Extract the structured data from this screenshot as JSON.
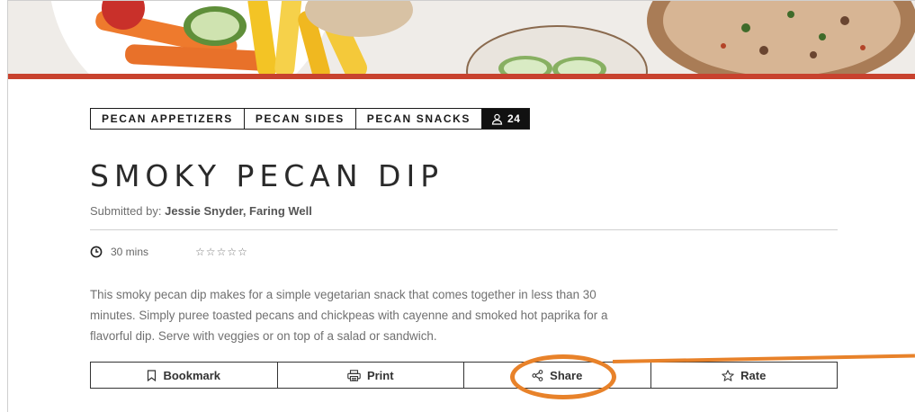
{
  "recipe": {
    "tags": [
      "PECAN APPETIZERS",
      "PECAN SIDES",
      "PECAN SNACKS"
    ],
    "user_count": "24",
    "title": "SMOKY PECAN DIP",
    "submitted_prefix": "Submitted by: ",
    "submitted_by": "Jessie Snyder, Faring Well",
    "time": "30 mins",
    "rating_stars": [
      "☆",
      "☆",
      "☆",
      "☆",
      "☆"
    ],
    "description": "This smoky pecan dip makes for a simple vegetarian snack that comes together in less than 30 minutes. Simply puree toasted pecans and chickpeas with cayenne and smoked hot paprika for a flavorful dip. Serve with veggies or on top of a salad or sandwich."
  },
  "actions": {
    "bookmark": "Bookmark",
    "print": "Print",
    "share": "Share",
    "rate": "Rate"
  },
  "colors": {
    "accent_bar": "#c8422e",
    "annotation": "#e8822a"
  }
}
